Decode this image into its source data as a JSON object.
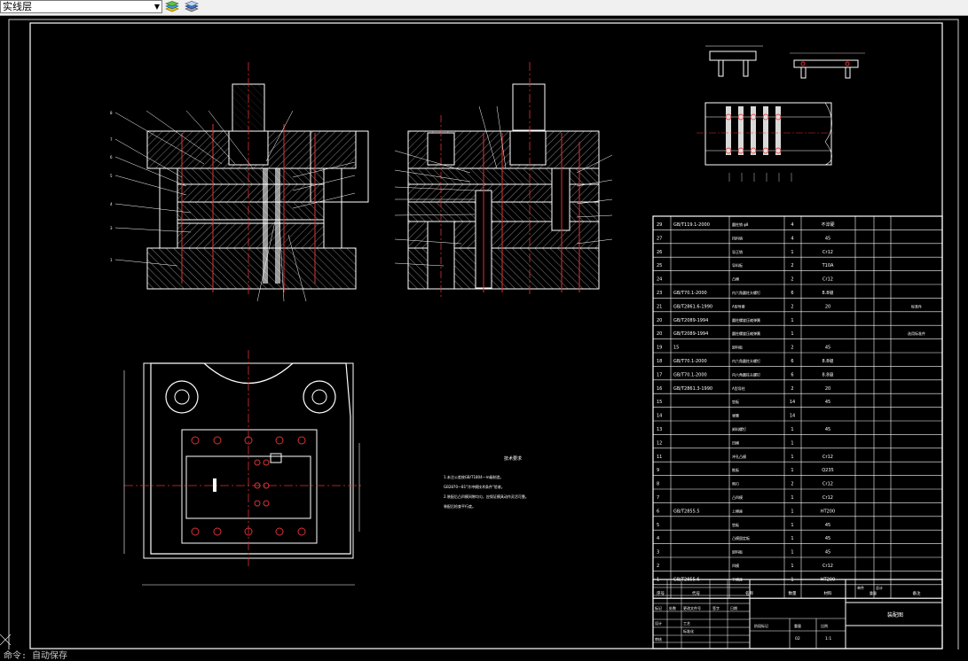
{
  "toolbar": {
    "layer_name": "实线层",
    "dropdown_icon": "chevron-down-icon",
    "icons": [
      "layer-states-icon",
      "layer-manager-icon"
    ]
  },
  "drawing": {
    "tech_title": "技术要求",
    "tech_lines": [
      "1.未注公差按GB/T1804—m级制造。",
      "GB2870—81\"冷冲模技术条件\"验收。",
      "2.装配后凸凹模间隙均匀，应保证模具动作灵活可靠。",
      "装配后检查平行度。"
    ],
    "bom_header": {
      "no": "序号",
      "code": "代号",
      "name": "名称",
      "qty": "数量",
      "material": "材料",
      "weight_single": "单件",
      "weight_total": "总计",
      "weight": "重量",
      "remark": "备注"
    },
    "bom_rows": [
      {
        "no": "29",
        "code": "GB/T119.1-2000",
        "name": "圆柱销 φ8",
        "qty": "4",
        "material": "不淬硬",
        "remark": ""
      },
      {
        "no": "27",
        "code": "",
        "name": "挡料销",
        "qty": "4",
        "material": "45",
        "remark": ""
      },
      {
        "no": "26",
        "code": "",
        "name": "导正销",
        "qty": "1",
        "material": "Cr12",
        "remark": ""
      },
      {
        "no": "25",
        "code": "",
        "name": "导料板",
        "qty": "2",
        "material": "T10A",
        "remark": ""
      },
      {
        "no": "24",
        "code": "",
        "name": "凸模",
        "qty": "2",
        "material": "Cr12",
        "remark": ""
      },
      {
        "no": "23",
        "code": "GB/T70.1-2000",
        "name": "内六角圆柱头螺钉",
        "qty": "6",
        "material": "8.8级",
        "remark": ""
      },
      {
        "no": "21",
        "code": "GB/T2861.6-1990",
        "name": "A型导套",
        "qty": "2",
        "material": "20",
        "remark": "标准件"
      },
      {
        "no": "20",
        "code": "GB/T2089-1994",
        "name": "圆柱螺旋压缩弹簧",
        "qty": "1",
        "material": "",
        "remark": ""
      },
      {
        "no": "20",
        "code": "GB/T2089-1994",
        "name": "圆柱螺旋压缩弹簧",
        "qty": "1",
        "material": "",
        "remark": "选用标准件"
      },
      {
        "no": "19",
        "code": "15",
        "name": "卸料板",
        "qty": "2",
        "material": "45",
        "remark": ""
      },
      {
        "no": "18",
        "code": "GB/T70.1-2000",
        "name": "内六角圆柱头螺钉",
        "qty": "6",
        "material": "8.8级",
        "remark": ""
      },
      {
        "no": "17",
        "code": "GB/T70.1-2000",
        "name": "内六角圆柱头螺钉",
        "qty": "6",
        "material": "8.8级",
        "remark": ""
      },
      {
        "no": "16",
        "code": "GB/T2861.3-1990",
        "name": "A型导柱",
        "qty": "2",
        "material": "20",
        "remark": ""
      },
      {
        "no": "15",
        "code": "",
        "name": "垫板",
        "qty": "14",
        "material": "45",
        "remark": ""
      },
      {
        "no": "14",
        "code": "",
        "name": "弹簧",
        "qty": "14",
        "material": "",
        "remark": ""
      },
      {
        "no": "13",
        "code": "",
        "name": "卸料螺钉",
        "qty": "1",
        "material": "45",
        "remark": ""
      },
      {
        "no": "12",
        "code": "",
        "name": "凹模",
        "qty": "1",
        "material": "",
        "remark": ""
      },
      {
        "no": "11",
        "code": "",
        "name": "冲孔凸模",
        "qty": "1",
        "material": "Cr12",
        "remark": ""
      },
      {
        "no": "9",
        "code": "",
        "name": "推板",
        "qty": "1",
        "material": "Q235",
        "remark": ""
      },
      {
        "no": "8",
        "code": "",
        "name": "侧刃",
        "qty": "2",
        "material": "Cr12",
        "remark": ""
      },
      {
        "no": "7",
        "code": "",
        "name": "凸凹模",
        "qty": "1",
        "material": "Cr12",
        "remark": ""
      },
      {
        "no": "6",
        "code": "GB/T2855.5",
        "name": "上模座",
        "qty": "1",
        "material": "HT200",
        "remark": ""
      },
      {
        "no": "5",
        "code": "",
        "name": "垫板",
        "qty": "1",
        "material": "45",
        "remark": ""
      },
      {
        "no": "4",
        "code": "",
        "name": "凸模固定板",
        "qty": "1",
        "material": "45",
        "remark": ""
      },
      {
        "no": "3",
        "code": "",
        "name": "卸料板",
        "qty": "1",
        "material": "45",
        "remark": ""
      },
      {
        "no": "2",
        "code": "",
        "name": "凹模",
        "qty": "1",
        "material": "Cr12",
        "remark": ""
      },
      {
        "no": "1",
        "code": "GB/T2855.6",
        "name": "下模座",
        "qty": "1",
        "material": "HT200",
        "remark": ""
      }
    ],
    "title_block": {
      "drawing_title": "装配图",
      "scale": "1:1",
      "sheet": "02",
      "labels": [
        "标记",
        "处数",
        "更改文件号",
        "签字",
        "日期",
        "设计",
        "审核",
        "工艺",
        "标准化",
        "阶段标记",
        "重量",
        "比例"
      ]
    }
  },
  "command_line": {
    "text": "命令: 自动保存"
  }
}
